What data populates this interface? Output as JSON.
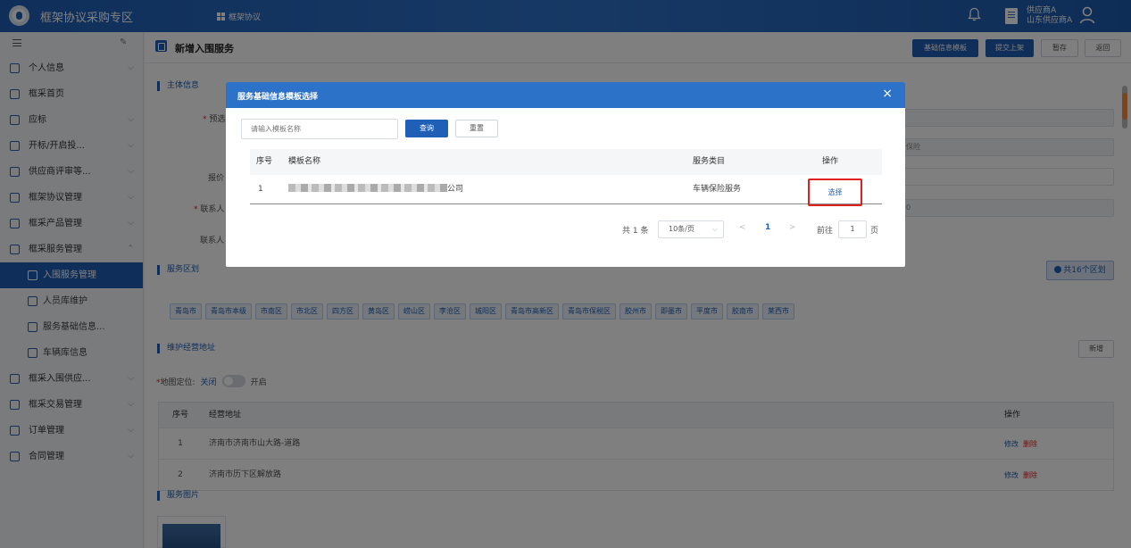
{
  "topbar": {
    "app_title": "框架协议采购专区",
    "nav_label": "框架协议",
    "user_line1": "供应商A",
    "user_line2": "山东供应商A"
  },
  "sidebar": {
    "items": [
      {
        "label": "个人信息",
        "arrow": "⌵"
      },
      {
        "label": "框采首页",
        "arrow": ""
      },
      {
        "label": "应标",
        "arrow": "⌵"
      },
      {
        "label": "开标/开启投...",
        "arrow": "⌵"
      },
      {
        "label": "供应商评审等...",
        "arrow": "⌵"
      },
      {
        "label": "框架协议管理",
        "arrow": "⌵"
      },
      {
        "label": "框采产品管理",
        "arrow": "⌵"
      },
      {
        "label": "框采服务管理",
        "arrow": "⌃"
      },
      {
        "label": "入围服务管理",
        "arrow": ""
      },
      {
        "label": "人员库维护",
        "arrow": ""
      },
      {
        "label": "服务基础信息...",
        "arrow": ""
      },
      {
        "label": "车辆库信息",
        "arrow": ""
      },
      {
        "label": "框采入围供应...",
        "arrow": "⌵"
      },
      {
        "label": "框采交易管理",
        "arrow": "⌵"
      },
      {
        "label": "订单管理",
        "arrow": "⌵"
      },
      {
        "label": "合同管理",
        "arrow": "⌵"
      }
    ]
  },
  "page": {
    "title": "新增入围服务",
    "btn_template": "基础信息模板",
    "btn_submit": "提交上架",
    "btn_save": "暂存",
    "btn_back": "返回"
  },
  "form": {
    "section_main": "主体信息",
    "label_preselect": "预选",
    "label_quote": "报价",
    "label_contact": "联系人",
    "label_contact2": "联系人",
    "value_service": "保险",
    "value_contact_tail": "0"
  },
  "region": {
    "section_title": "服务区划",
    "count_label": "共16个区划",
    "tags": [
      "青岛市",
      "青岛市本级",
      "市南区",
      "市北区",
      "四方区",
      "黄岛区",
      "崂山区",
      "李沧区",
      "城阳区",
      "青岛市高新区",
      "青岛市保税区",
      "胶州市",
      "即墨市",
      "平度市",
      "胶南市",
      "莱西市"
    ]
  },
  "address": {
    "section_title": "维护经营地址",
    "add_button": "新增",
    "map_label": "地图定位:",
    "map_off": "关闭",
    "map_on": "开启",
    "headers": {
      "no": "序号",
      "addr": "经营地址",
      "op": "操作"
    },
    "rows": [
      {
        "no": "1",
        "addr": "济南市济南市山大路-道路",
        "edit": "修改",
        "delete": "删除"
      },
      {
        "no": "2",
        "addr": "济南市历下区解放路",
        "edit": "修改",
        "delete": "删除"
      }
    ]
  },
  "images": {
    "section_title": "服务图片"
  },
  "modal": {
    "title": "服务基础信息模板选择",
    "close": "×",
    "search_placeholder": "请输入模板名称",
    "query_button": "查询",
    "reset_button": "重置",
    "headers": {
      "no": "序号",
      "name": "模板名称",
      "category": "服务类目",
      "op": "操作"
    },
    "row": {
      "no": "1",
      "name_suffix": "公司",
      "category": "车辆保险服务",
      "select": "选择"
    },
    "pagination": {
      "total": "共 1 条",
      "page_size": "10条/页",
      "prev": "<",
      "current": "1",
      "next": ">",
      "goto": "前往",
      "goto_value": "1",
      "unit": "页"
    }
  },
  "colors": {
    "primary": "#1f5fb5",
    "modal_header": "#2d72c9",
    "danger": "#e02020",
    "highlight": "#e02020"
  }
}
